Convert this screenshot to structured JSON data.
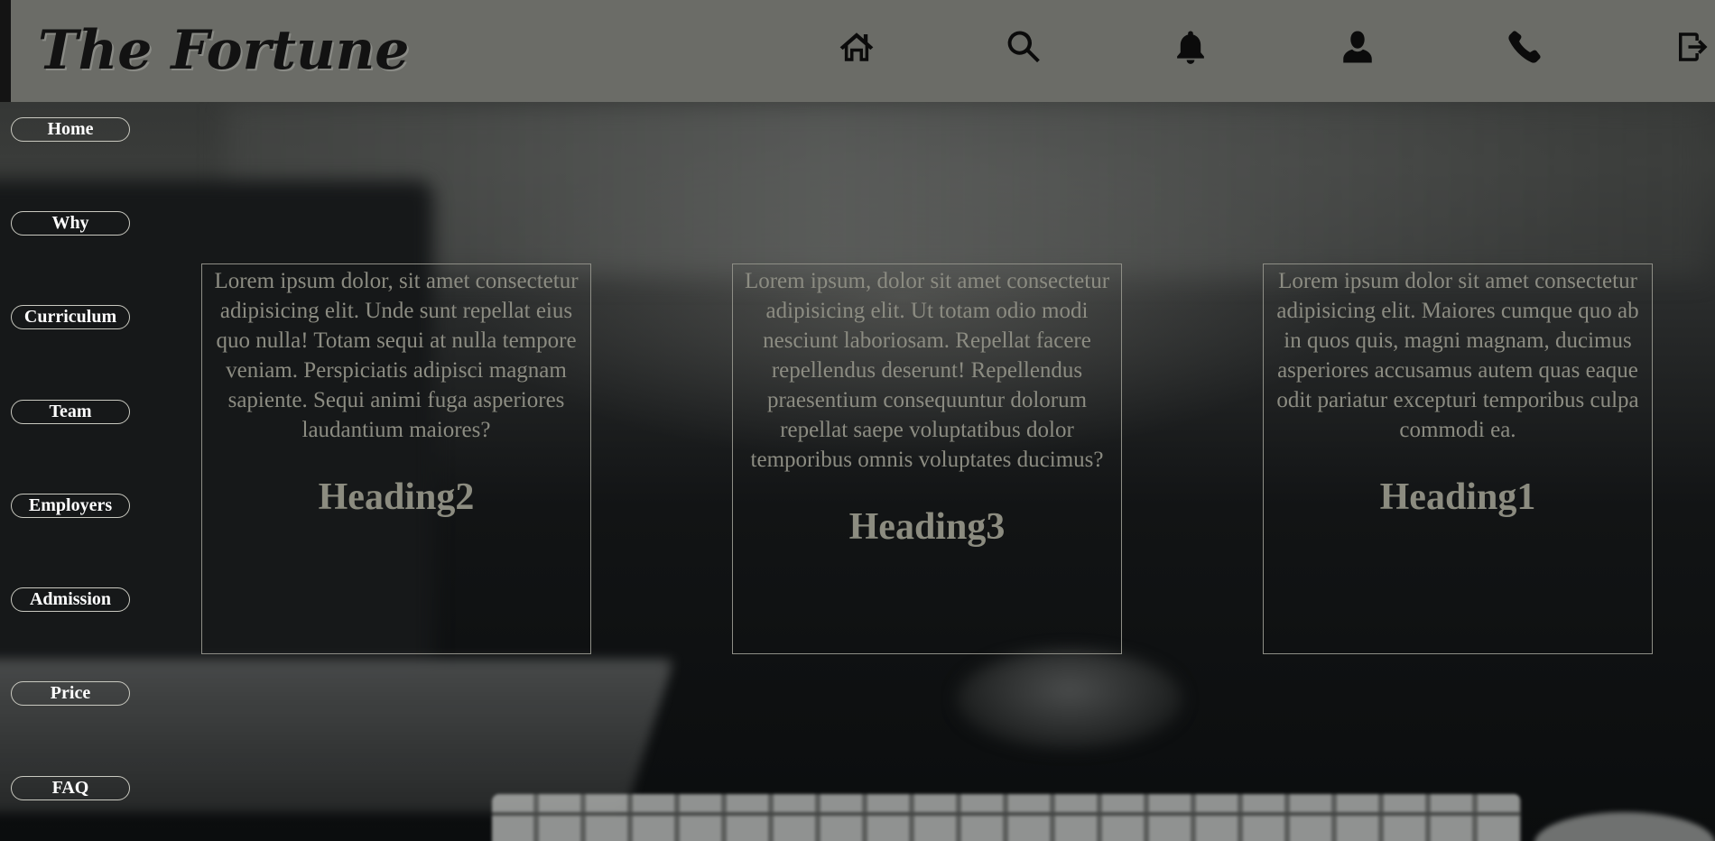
{
  "header": {
    "title": "The Fortune",
    "icons": [
      "home-icon",
      "search-icon",
      "bell-icon",
      "user-icon",
      "phone-icon",
      "logout-icon"
    ]
  },
  "sidebar": {
    "items": [
      {
        "label": "Home"
      },
      {
        "label": "Why"
      },
      {
        "label": "Curriculum"
      },
      {
        "label": "Team"
      },
      {
        "label": "Employers"
      },
      {
        "label": "Admission"
      },
      {
        "label": "Price"
      },
      {
        "label": "FAQ"
      }
    ]
  },
  "cards": [
    {
      "text": "Lorem ipsum dolor, sit amet consectetur adipisicing elit. Unde sunt repellat eius quo nulla! Totam sequi at nulla tempore veniam. Perspiciatis adipisci magnam sapiente. Sequi animi fuga asperiores laudantium maiores?",
      "heading": "Heading2"
    },
    {
      "text": "Lorem ipsum, dolor sit amet consectetur adipisicing elit. Ut totam odio modi nesciunt laboriosam. Repellat facere repellendus deserunt! Repellendus praesentium consequuntur dolorum repellat saepe voluptatibus dolor temporibus omnis voluptates ducimus?",
      "heading": "Heading3"
    },
    {
      "text": "Lorem ipsum dolor sit amet consectetur adipisicing elit. Maiores cumque quo ab in quos quis, magni magnam, ducimus asperiores accusamus autem quas eaque odit pariatur excepturi temporibus culpa commodi ea.",
      "heading": "Heading1"
    }
  ],
  "colors": {
    "header_bg": "#6b6c67",
    "card_text": "#8c8c82",
    "card_border": "#8e8e86",
    "sidebar_text": "#ffffff"
  }
}
